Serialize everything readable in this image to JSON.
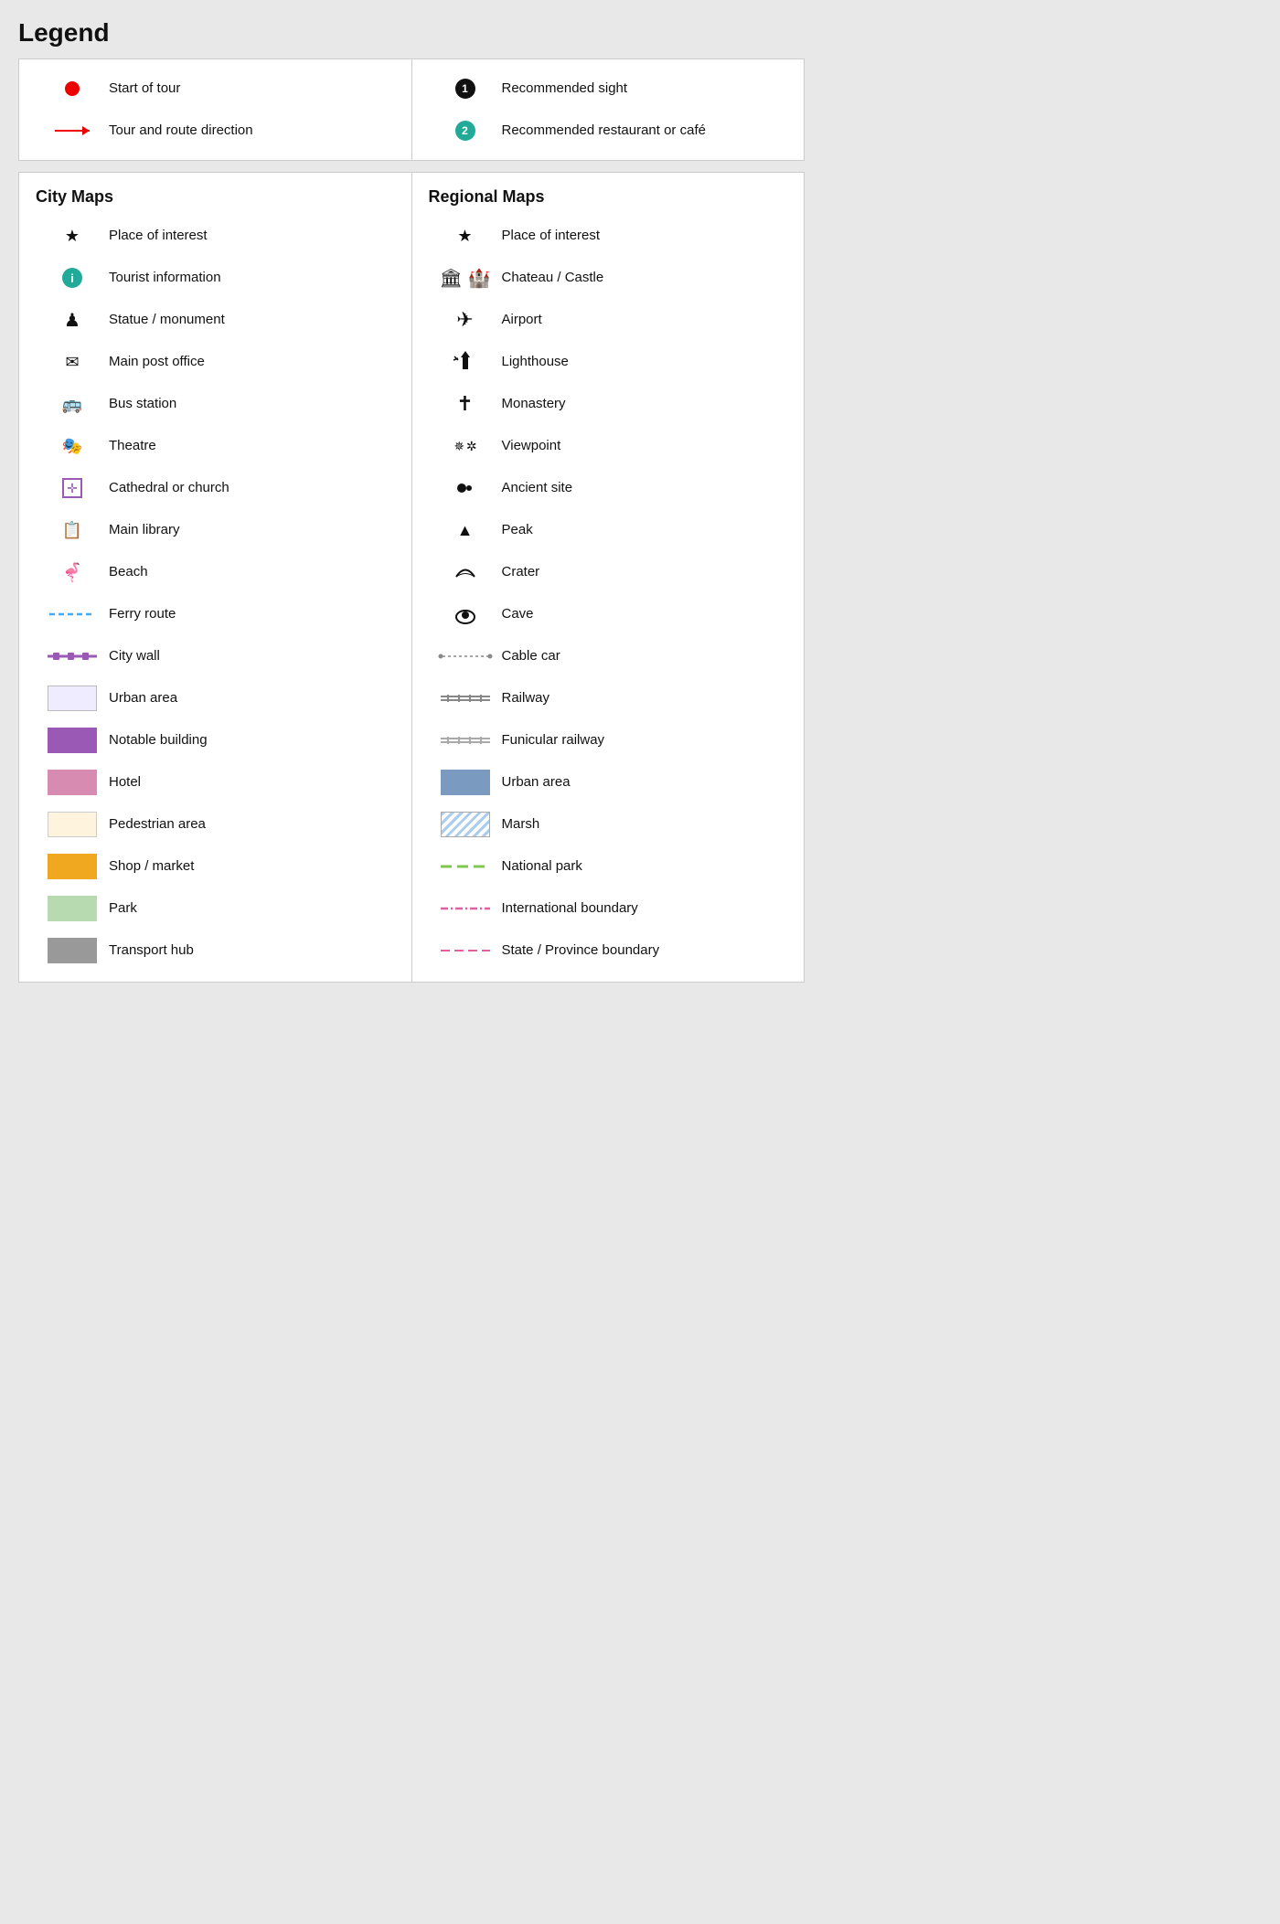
{
  "title": "Legend",
  "top": {
    "left": [
      {
        "id": "start-of-tour",
        "icon": "dot-red",
        "label": "Start of tour"
      },
      {
        "id": "tour-direction",
        "icon": "arrow-red",
        "label": "Tour and route direction"
      }
    ],
    "right": [
      {
        "id": "recommended-sight",
        "icon": "circle-1",
        "label": "Recommended sight"
      },
      {
        "id": "recommended-restaurant",
        "icon": "circle-2",
        "label": "Recommended restaurant or café"
      }
    ]
  },
  "city": {
    "title": "City Maps",
    "items": [
      {
        "id": "place-of-interest-city",
        "icon": "star",
        "label": "Place of interest"
      },
      {
        "id": "tourist-information",
        "icon": "info-green",
        "label": "Tourist information"
      },
      {
        "id": "statue-monument",
        "icon": "chess",
        "label": "Statue / monument"
      },
      {
        "id": "main-post-office",
        "icon": "envelope",
        "label": "Main post office"
      },
      {
        "id": "bus-station",
        "icon": "bus",
        "label": "Bus station"
      },
      {
        "id": "theatre",
        "icon": "theatre",
        "label": "Theatre"
      },
      {
        "id": "cathedral-church",
        "icon": "church-box",
        "label": "Cathedral or church"
      },
      {
        "id": "main-library",
        "icon": "library",
        "label": "Main library"
      },
      {
        "id": "beach",
        "icon": "beach",
        "label": "Beach"
      },
      {
        "id": "ferry-route",
        "icon": "ferry-dash",
        "label": "Ferry route"
      },
      {
        "id": "city-wall",
        "icon": "city-wall",
        "label": "City wall"
      },
      {
        "id": "urban-area-city",
        "icon": "box-urban",
        "label": "Urban area"
      },
      {
        "id": "notable-building",
        "icon": "box-notable",
        "label": "Notable building"
      },
      {
        "id": "hotel",
        "icon": "box-hotel",
        "label": "Hotel"
      },
      {
        "id": "pedestrian-area",
        "icon": "box-pedestrian",
        "label": "Pedestrian area"
      },
      {
        "id": "shop-market",
        "icon": "box-shop",
        "label": "Shop / market"
      },
      {
        "id": "park",
        "icon": "box-park",
        "label": "Park"
      },
      {
        "id": "transport-hub",
        "icon": "box-transport",
        "label": "Transport hub"
      }
    ]
  },
  "regional": {
    "title": "Regional Maps",
    "items": [
      {
        "id": "place-of-interest-reg",
        "icon": "star",
        "label": "Place of interest"
      },
      {
        "id": "chateau-castle",
        "icon": "castle",
        "label": "Chateau / Castle"
      },
      {
        "id": "airport",
        "icon": "airport",
        "label": "Airport"
      },
      {
        "id": "lighthouse",
        "icon": "lighthouse",
        "label": "Lighthouse"
      },
      {
        "id": "monastery",
        "icon": "cross",
        "label": "Monastery"
      },
      {
        "id": "viewpoint",
        "icon": "viewpoint",
        "label": "Viewpoint"
      },
      {
        "id": "ancient-site",
        "icon": "ancient",
        "label": "Ancient site"
      },
      {
        "id": "peak",
        "icon": "peak",
        "label": "Peak"
      },
      {
        "id": "crater",
        "icon": "crater",
        "label": "Crater"
      },
      {
        "id": "cave",
        "icon": "cave",
        "label": "Cave"
      },
      {
        "id": "cable-car",
        "icon": "cable-car",
        "label": "Cable car"
      },
      {
        "id": "railway",
        "icon": "railway",
        "label": "Railway"
      },
      {
        "id": "funicular-railway",
        "icon": "funicular",
        "label": "Funicular railway"
      },
      {
        "id": "urban-area-reg",
        "icon": "box-urban-reg",
        "label": "Urban area"
      },
      {
        "id": "marsh",
        "icon": "box-marsh",
        "label": "Marsh"
      },
      {
        "id": "national-park",
        "icon": "natpark",
        "label": "National park"
      },
      {
        "id": "international-boundary",
        "icon": "intl-boundary",
        "label": "International boundary"
      },
      {
        "id": "state-boundary",
        "icon": "state-boundary",
        "label": "State / Province boundary"
      }
    ]
  }
}
